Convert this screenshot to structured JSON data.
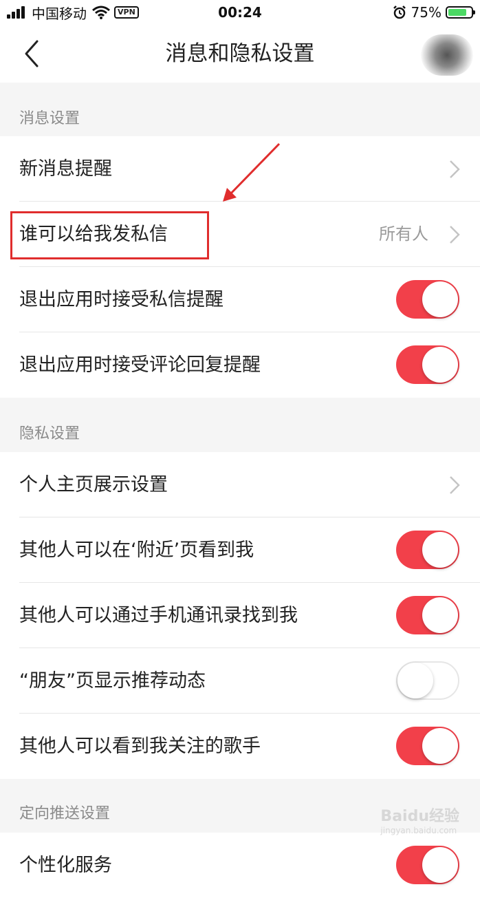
{
  "status_bar": {
    "carrier": "中国移动",
    "vpn": "VPN",
    "time": "00:24",
    "battery": "75%"
  },
  "nav": {
    "title": "消息和隐私设置"
  },
  "sections": {
    "message": {
      "header": "消息设置"
    },
    "privacy": {
      "header": "隐私设置"
    },
    "targeted": {
      "header": "定向推送设置"
    }
  },
  "rows": {
    "new_message": {
      "label": "新消息提醒"
    },
    "who_can_dm": {
      "label": "谁可以给我发私信",
      "value": "所有人"
    },
    "dm_notify_on_exit": {
      "label": "退出应用时接受私信提醒",
      "state": "on"
    },
    "comment_notify_on_exit": {
      "label": "退出应用时接受评论回复提醒",
      "state": "on"
    },
    "profile_display": {
      "label": "个人主页展示设置"
    },
    "nearby_visible": {
      "label": "其他人可以在‘附近’页看到我",
      "state": "on"
    },
    "find_by_contacts": {
      "label": "其他人可以通过手机通讯录找到我",
      "state": "on"
    },
    "friends_recommend": {
      "label": "“朋友”页显示推荐动态",
      "state": "off"
    },
    "followed_singers": {
      "label": "其他人可以看到我关注的歌手",
      "state": "on"
    },
    "personalized_service": {
      "label": "个性化服务",
      "state": "on"
    }
  },
  "watermark": {
    "text": "Baidu经验",
    "sub": "jingyan.baidu.com"
  },
  "colors": {
    "toggle_on": "#f2404a",
    "highlight": "#e02d2d",
    "background": "#f5f5f5"
  }
}
